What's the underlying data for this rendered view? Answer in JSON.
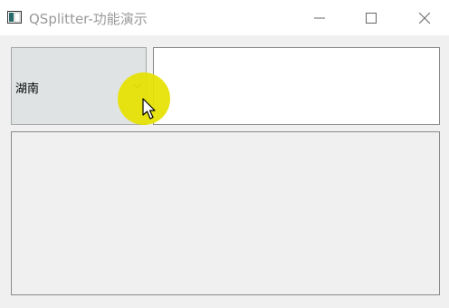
{
  "window": {
    "title": "QSplitter-功能演示",
    "icon": "app-window-icon",
    "controls": [
      "minimize-icon",
      "maximize-icon",
      "close-icon"
    ]
  },
  "combo": {
    "selected": "湖南",
    "arrow_icon": "chevron-down-icon"
  },
  "cursor": {
    "icon": "mouse-pointer-icon",
    "highlight_color": "#e6e100"
  }
}
